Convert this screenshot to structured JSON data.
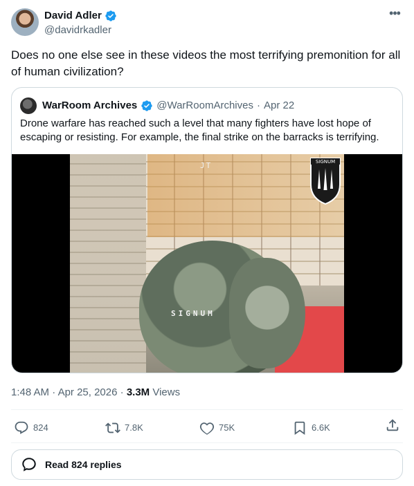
{
  "author": {
    "display_name": "David Adler",
    "handle": "@davidrkadler"
  },
  "tweet": {
    "text": "Does no one else see in these videos the most terrifying premonition for all of human civilization?"
  },
  "quote": {
    "display_name": "WarRoom Archives",
    "handle": "@WarRoomArchives",
    "separator": "·",
    "date": "Apr 22",
    "text": "Drone warfare has reached such a level that many fighters have lost hope of escaping or resisting. For example, the final strike on the barracks is terrifying.",
    "media": {
      "overlay_top": "JT",
      "overlay_middle": "SIGNUM",
      "logo_text": "SIGNUM"
    }
  },
  "meta": {
    "time": "1:48 AM",
    "separator1": "·",
    "date": "Apr 25, 2026",
    "separator2": "·",
    "views_count": "3.3M",
    "views_label": "Views"
  },
  "actions": {
    "replies": "824",
    "reposts": "7.8K",
    "likes": "75K",
    "bookmarks": "6.6K"
  },
  "read_replies": {
    "label": "Read 824 replies"
  },
  "icons": {
    "verified": "verified-badge-icon",
    "more": "more-options-icon",
    "reply": "reply-icon",
    "repost": "repost-icon",
    "like": "heart-icon",
    "bookmark": "bookmark-icon",
    "share": "share-icon",
    "replies": "speech-bubble-icon"
  },
  "colors": {
    "verified": "#1d9bf0",
    "secondary_text": "#536471",
    "primary_text": "#0f1419",
    "border": "#cfd9de"
  }
}
